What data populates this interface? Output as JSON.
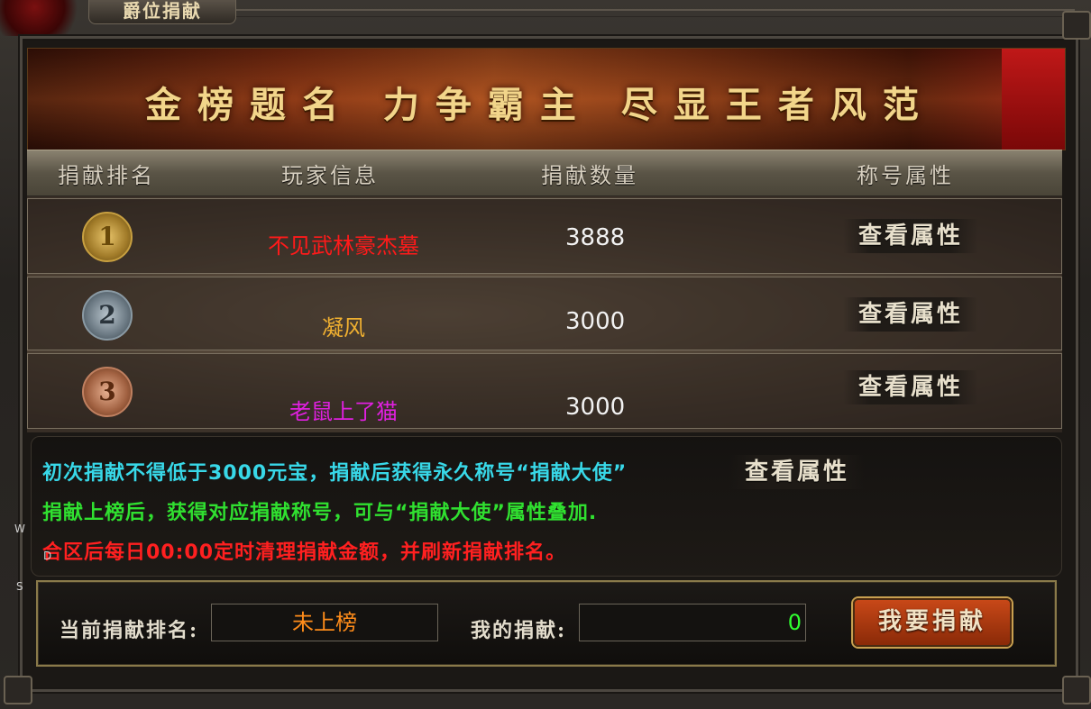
{
  "window": {
    "title": "爵位捐献"
  },
  "banner": {
    "slogan": "金榜题名 力争霸主 尽显王者风范"
  },
  "table": {
    "headers": [
      "捐献排名",
      "玩家信息",
      "捐献数量",
      "称号属性"
    ],
    "rows": [
      {
        "rank": "1",
        "medal": "gold",
        "player": "不见武林豪杰墓",
        "player_color": "#ff1a1a",
        "amount": "3888",
        "action": "查看属性"
      },
      {
        "rank": "2",
        "medal": "silver",
        "player": "凝风",
        "player_color": "#f0b030",
        "amount": "3000",
        "action": "查看属性"
      },
      {
        "rank": "3",
        "medal": "bronze",
        "player": "老鼠上了猫",
        "player_color": "#e020e0",
        "amount": "3000",
        "action": "查看属性"
      }
    ]
  },
  "notice": {
    "line1": "初次捐献不得低于3000元宝，捐献后获得永久称号“捐献大使”",
    "line2": "捐献上榜后，获得对应捐献称号，可与“捐献大使”属性叠加.",
    "line3": "合区后每日00:00定时清理捐献金额，并刷新捐献排名。",
    "view_button": "查看属性",
    "colors": {
      "line1": "#38d8e8",
      "line2": "#30e030",
      "line3": "#ff2020"
    }
  },
  "footer": {
    "rank_label": "当前捐献排名:",
    "rank_value": "未上榜",
    "my_label": "我的捐献:",
    "my_value": "0",
    "donate_button": "我要捐献"
  },
  "side_letters": [
    "W",
    "D",
    "S"
  ]
}
